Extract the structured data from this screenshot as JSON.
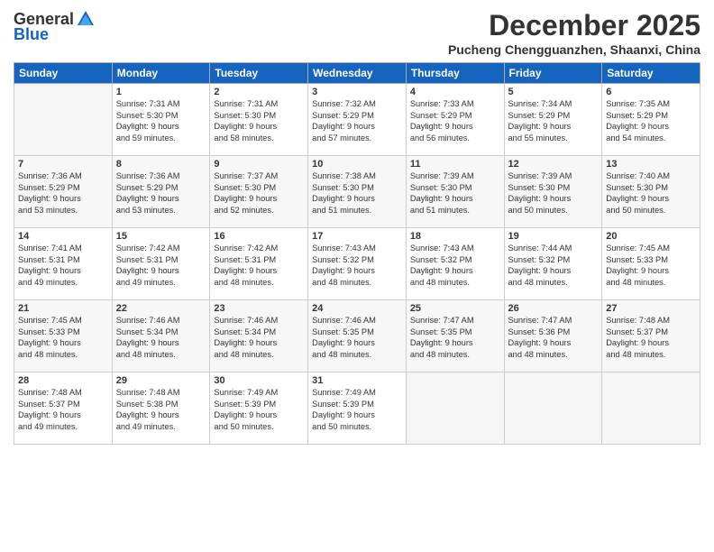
{
  "logo": {
    "general": "General",
    "blue": "Blue"
  },
  "title": "December 2025",
  "location": "Pucheng Chengguanzhen, Shaanxi, China",
  "days_of_week": [
    "Sunday",
    "Monday",
    "Tuesday",
    "Wednesday",
    "Thursday",
    "Friday",
    "Saturday"
  ],
  "weeks": [
    [
      {
        "day": "",
        "info": "",
        "empty": true
      },
      {
        "day": "1",
        "info": "Sunrise: 7:31 AM\nSunset: 5:30 PM\nDaylight: 9 hours\nand 59 minutes."
      },
      {
        "day": "2",
        "info": "Sunrise: 7:31 AM\nSunset: 5:30 PM\nDaylight: 9 hours\nand 58 minutes."
      },
      {
        "day": "3",
        "info": "Sunrise: 7:32 AM\nSunset: 5:29 PM\nDaylight: 9 hours\nand 57 minutes."
      },
      {
        "day": "4",
        "info": "Sunrise: 7:33 AM\nSunset: 5:29 PM\nDaylight: 9 hours\nand 56 minutes."
      },
      {
        "day": "5",
        "info": "Sunrise: 7:34 AM\nSunset: 5:29 PM\nDaylight: 9 hours\nand 55 minutes."
      },
      {
        "day": "6",
        "info": "Sunrise: 7:35 AM\nSunset: 5:29 PM\nDaylight: 9 hours\nand 54 minutes."
      }
    ],
    [
      {
        "day": "7",
        "info": "Sunrise: 7:36 AM\nSunset: 5:29 PM\nDaylight: 9 hours\nand 53 minutes."
      },
      {
        "day": "8",
        "info": "Sunrise: 7:36 AM\nSunset: 5:29 PM\nDaylight: 9 hours\nand 53 minutes."
      },
      {
        "day": "9",
        "info": "Sunrise: 7:37 AM\nSunset: 5:30 PM\nDaylight: 9 hours\nand 52 minutes."
      },
      {
        "day": "10",
        "info": "Sunrise: 7:38 AM\nSunset: 5:30 PM\nDaylight: 9 hours\nand 51 minutes."
      },
      {
        "day": "11",
        "info": "Sunrise: 7:39 AM\nSunset: 5:30 PM\nDaylight: 9 hours\nand 51 minutes."
      },
      {
        "day": "12",
        "info": "Sunrise: 7:39 AM\nSunset: 5:30 PM\nDaylight: 9 hours\nand 50 minutes."
      },
      {
        "day": "13",
        "info": "Sunrise: 7:40 AM\nSunset: 5:30 PM\nDaylight: 9 hours\nand 50 minutes."
      }
    ],
    [
      {
        "day": "14",
        "info": "Sunrise: 7:41 AM\nSunset: 5:31 PM\nDaylight: 9 hours\nand 49 minutes."
      },
      {
        "day": "15",
        "info": "Sunrise: 7:42 AM\nSunset: 5:31 PM\nDaylight: 9 hours\nand 49 minutes."
      },
      {
        "day": "16",
        "info": "Sunrise: 7:42 AM\nSunset: 5:31 PM\nDaylight: 9 hours\nand 48 minutes."
      },
      {
        "day": "17",
        "info": "Sunrise: 7:43 AM\nSunset: 5:32 PM\nDaylight: 9 hours\nand 48 minutes."
      },
      {
        "day": "18",
        "info": "Sunrise: 7:43 AM\nSunset: 5:32 PM\nDaylight: 9 hours\nand 48 minutes."
      },
      {
        "day": "19",
        "info": "Sunrise: 7:44 AM\nSunset: 5:32 PM\nDaylight: 9 hours\nand 48 minutes."
      },
      {
        "day": "20",
        "info": "Sunrise: 7:45 AM\nSunset: 5:33 PM\nDaylight: 9 hours\nand 48 minutes."
      }
    ],
    [
      {
        "day": "21",
        "info": "Sunrise: 7:45 AM\nSunset: 5:33 PM\nDaylight: 9 hours\nand 48 minutes."
      },
      {
        "day": "22",
        "info": "Sunrise: 7:46 AM\nSunset: 5:34 PM\nDaylight: 9 hours\nand 48 minutes."
      },
      {
        "day": "23",
        "info": "Sunrise: 7:46 AM\nSunset: 5:34 PM\nDaylight: 9 hours\nand 48 minutes."
      },
      {
        "day": "24",
        "info": "Sunrise: 7:46 AM\nSunset: 5:35 PM\nDaylight: 9 hours\nand 48 minutes."
      },
      {
        "day": "25",
        "info": "Sunrise: 7:47 AM\nSunset: 5:35 PM\nDaylight: 9 hours\nand 48 minutes."
      },
      {
        "day": "26",
        "info": "Sunrise: 7:47 AM\nSunset: 5:36 PM\nDaylight: 9 hours\nand 48 minutes."
      },
      {
        "day": "27",
        "info": "Sunrise: 7:48 AM\nSunset: 5:37 PM\nDaylight: 9 hours\nand 48 minutes."
      }
    ],
    [
      {
        "day": "28",
        "info": "Sunrise: 7:48 AM\nSunset: 5:37 PM\nDaylight: 9 hours\nand 49 minutes."
      },
      {
        "day": "29",
        "info": "Sunrise: 7:48 AM\nSunset: 5:38 PM\nDaylight: 9 hours\nand 49 minutes."
      },
      {
        "day": "30",
        "info": "Sunrise: 7:49 AM\nSunset: 5:39 PM\nDaylight: 9 hours\nand 50 minutes."
      },
      {
        "day": "31",
        "info": "Sunrise: 7:49 AM\nSunset: 5:39 PM\nDaylight: 9 hours\nand 50 minutes."
      },
      {
        "day": "",
        "info": "",
        "empty": true
      },
      {
        "day": "",
        "info": "",
        "empty": true
      },
      {
        "day": "",
        "info": "",
        "empty": true
      }
    ]
  ]
}
